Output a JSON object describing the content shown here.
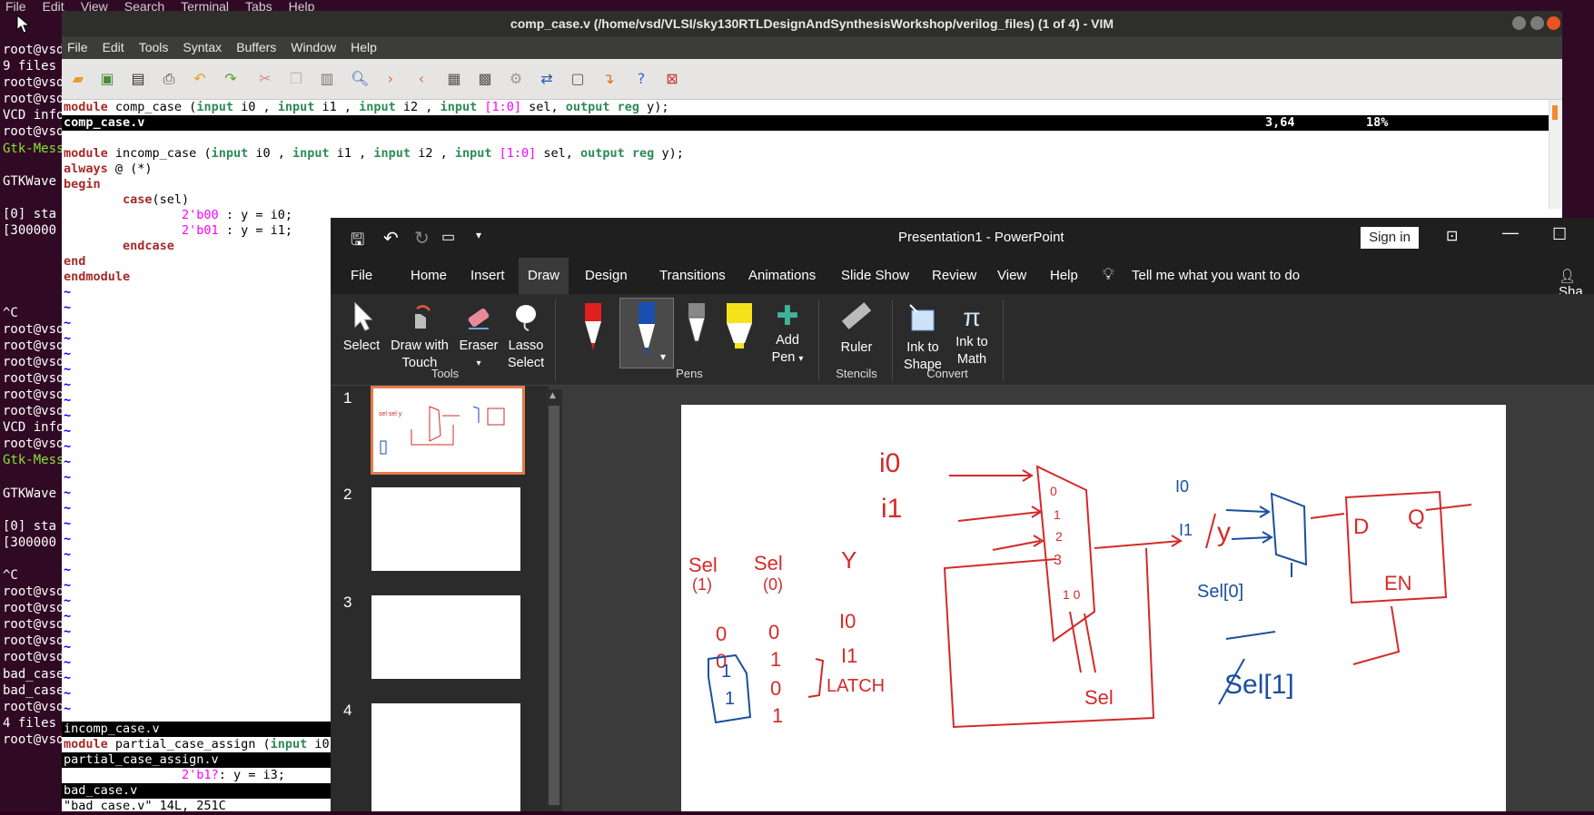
{
  "terminal": {
    "menu": [
      "File",
      "Edit",
      "View",
      "Search",
      "Terminal",
      "Tabs",
      "Help"
    ],
    "lines": [
      "root@vsd",
      "9 files",
      "root@vsd",
      "root@vsd",
      "VCD info",
      "root@vsd",
      "Gtk-Mess",
      "",
      "GTKWave",
      "",
      "[0] sta",
      "[300000",
      "",
      "",
      "",
      "",
      "^C",
      "root@vsd",
      "root@vsd",
      "root@vsd",
      "root@vsd",
      "root@vsd",
      "root@vsd",
      "VCD info",
      "root@vsd",
      "Gtk-Mess",
      "",
      "GTKWave",
      "",
      "[0] sta",
      "[300000",
      "",
      "^C",
      "root@vsd",
      "root@vsd",
      "root@vsd",
      "root@vsd",
      "root@vsd",
      "bad_case",
      "bad_case",
      "root@vsd",
      "4 files",
      "root@vsd"
    ]
  },
  "gvim": {
    "title": "comp_case.v (/home/vsd/VLSI/sky130RTLDesignAndSynthesisWorkshop/verilog_files) (1 of 4) - VIM",
    "menu": [
      "File",
      "Edit",
      "Tools",
      "Syntax",
      "Buffers",
      "Window",
      "Help"
    ],
    "line1": {
      "a": "module ",
      "b": "comp_case (",
      "c": "input",
      " d": " i0 , ",
      "e": "input",
      "f": " i1 , ",
      "g": "input",
      "h": " i2 , ",
      "i": "input",
      "j": " [1:0] ",
      "k": "sel, ",
      "l": "output reg",
      " m": " y);"
    },
    "status1_name": "comp_case.v",
    "status1_pos": "3,64",
    "status1_pct": "18%",
    "code": {
      "l1_kw": "module",
      "l1_rest": " incomp_case (",
      "l1_in1": "input",
      "l1_i0": " i0 , ",
      "l1_in2": "input",
      "l1_i1": " i1 , ",
      "l1_in3": "input",
      "l1_i2": " i2 , ",
      "l1_in4": "input",
      "l1_r": " [1:0] ",
      "l1_sel": "sel, ",
      "l1_out": "output reg",
      "l1_y": " y);",
      "always": "always",
      "always_rest": " @ (*)",
      "begin": "begin",
      "case": "case",
      "case_rest": "(sel)",
      "c1_num": "2'b00",
      "c1_rest": " : y = i0;",
      "c2_num": "2'b01",
      "c2_rest": " : y = i1;",
      "endcase": "endcase",
      "end": "end",
      "endmodule": "endmodule"
    },
    "tilde": "~",
    "bottom": {
      "status2": "incomp_case.v",
      "l2_kw": "module",
      "l2_rest": " partial_case_assign (",
      "l2_in": "input",
      "l2_i0": " i0",
      "status3": "partial_case_assign.v",
      "l3_num": "2'b1?",
      "l3_rest": ": y = i3;",
      "status4": "bad_case.v",
      "msg": "\"bad_case.v\" 14L, 251C"
    }
  },
  "ppt": {
    "title": "Presentation1  -  PowerPoint",
    "sign_in": "Sign in",
    "tabs": [
      "File",
      "Home",
      "Insert",
      "Draw",
      "Design",
      "Transitions",
      "Animations",
      "Slide Show",
      "Review",
      "View",
      "Help"
    ],
    "tell_me": "Tell me what you want to do",
    "share": "Sha",
    "ribbon": {
      "select": "Select",
      "draw_touch_1": "Draw with",
      "draw_touch_2": "Touch",
      "eraser": "Eraser",
      "lasso_1": "Lasso",
      "lasso_2": "Select",
      "tools": "Tools",
      "add_pen_1": "Add",
      "add_pen_2": "Pen",
      "pens": "Pens",
      "ruler": "Ruler",
      "stencils": "Stencils",
      "ink_shape_1": "Ink to",
      "ink_shape_2": "Shape",
      "ink_math_1": "Ink to",
      "ink_math_2": "Math",
      "convert": "Convert"
    },
    "slides": [
      "1",
      "2",
      "3",
      "4"
    ],
    "slide_ink": {
      "i0": "i0",
      "i1": "i1",
      "y_out": "y",
      "sel1": "Sel",
      "sel1b": "(1)",
      "sel0": "Sel",
      "sel0b": "(0)",
      "y_col": "Y",
      "r1a": "0",
      "r1b": "0",
      "r1c": "I0",
      "r2a": "0",
      "r2b": "1",
      "r2c": "I1",
      "r3a": "1",
      "r3b": "0",
      "r4a": "1",
      "r4b": "1",
      "latch": "LATCH",
      "m0": "0",
      "m1": "1",
      "m2": "2",
      "m3": "3",
      "mb": "1 0",
      "sel_bottom": "Sel",
      "ri0": "I0",
      "ri1": "I1",
      "rsel0": "Sel[0]",
      "d": "D",
      "q": "Q",
      "en": "EN",
      "sel1_blue": "Sel[1]"
    },
    "colors": {
      "ink_red": "#d42a2a",
      "ink_blue": "#1a4fa0"
    }
  }
}
